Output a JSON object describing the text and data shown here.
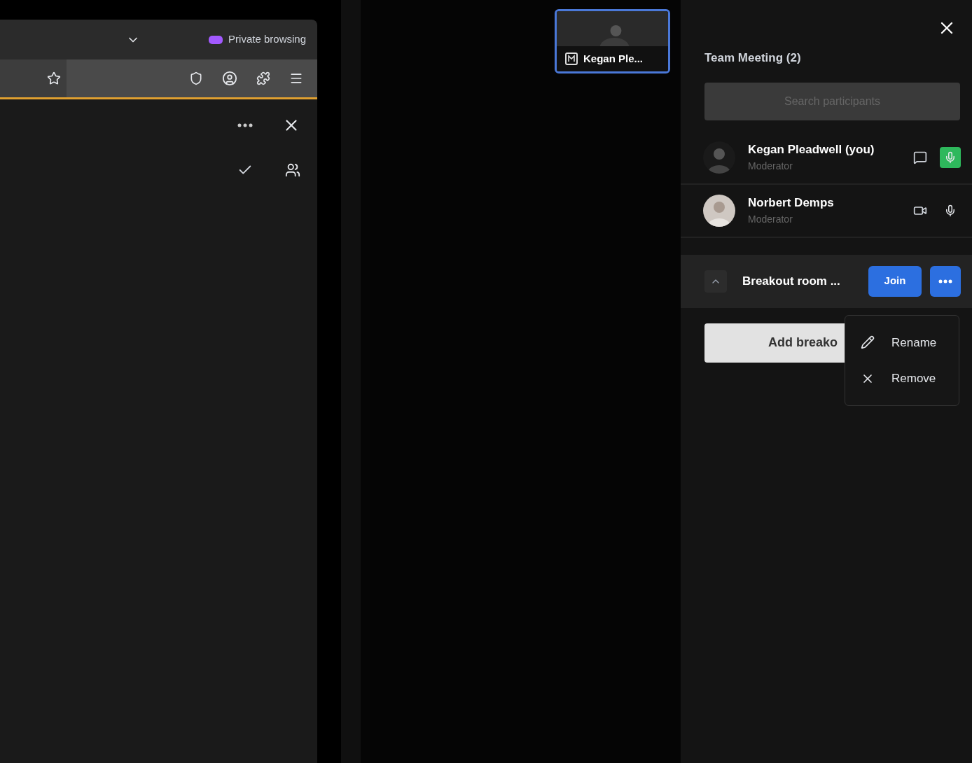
{
  "browser": {
    "private_label": "Private browsing"
  },
  "video_tile": {
    "name": "Kegan Ple...",
    "selected": true
  },
  "panel": {
    "title": "Team Meeting (2)",
    "search": {
      "placeholder": "Search participants"
    },
    "participants": [
      {
        "name": "Kegan Pleadwell (you)",
        "role": "Moderator",
        "mic_active": true
      },
      {
        "name": "Norbert Demps",
        "role": "Moderator",
        "mic_active": false
      }
    ],
    "breakout": {
      "name": "Breakout room ...",
      "expanded": true,
      "join": "Join",
      "add_button": "Add breako"
    },
    "menu": [
      {
        "kind": "rename",
        "label": "Rename"
      },
      {
        "kind": "remove",
        "label": "Remove"
      }
    ]
  }
}
